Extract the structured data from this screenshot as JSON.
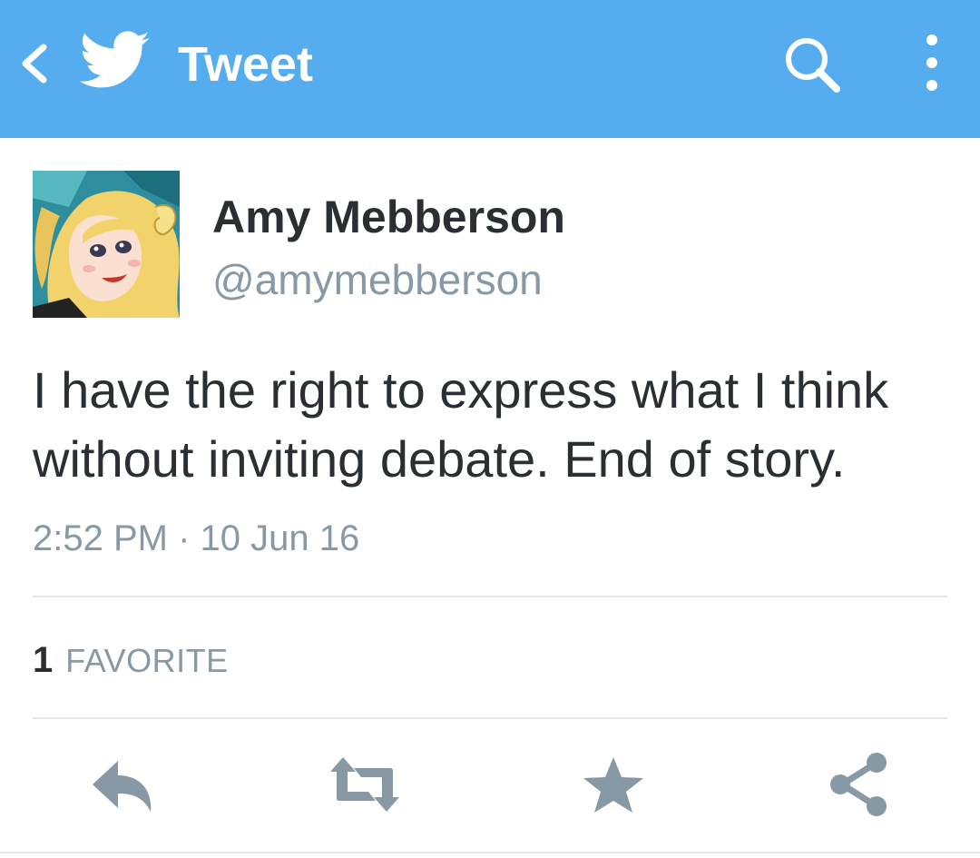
{
  "header": {
    "title": "Tweet",
    "back_icon": "back-chevron-icon",
    "logo_icon": "twitter-bird-icon",
    "search_icon": "search-icon",
    "menu_icon": "more-vertical-icon",
    "background_color": "#55acee"
  },
  "tweet": {
    "author_name": "Amy Mebberson",
    "author_handle": "@amymebberson",
    "text": "I have the right to express what I think without inviting debate. End of story.",
    "timestamp": "2:52 PM · 10 Jun 16"
  },
  "stats": {
    "favorites_count": "1",
    "favorites_label": "FAVORITE"
  },
  "actions": {
    "reply_icon": "reply-icon",
    "retweet_icon": "retweet-icon",
    "favorite_icon": "star-icon",
    "share_icon": "share-icon",
    "icon_color": "#8899a6"
  }
}
